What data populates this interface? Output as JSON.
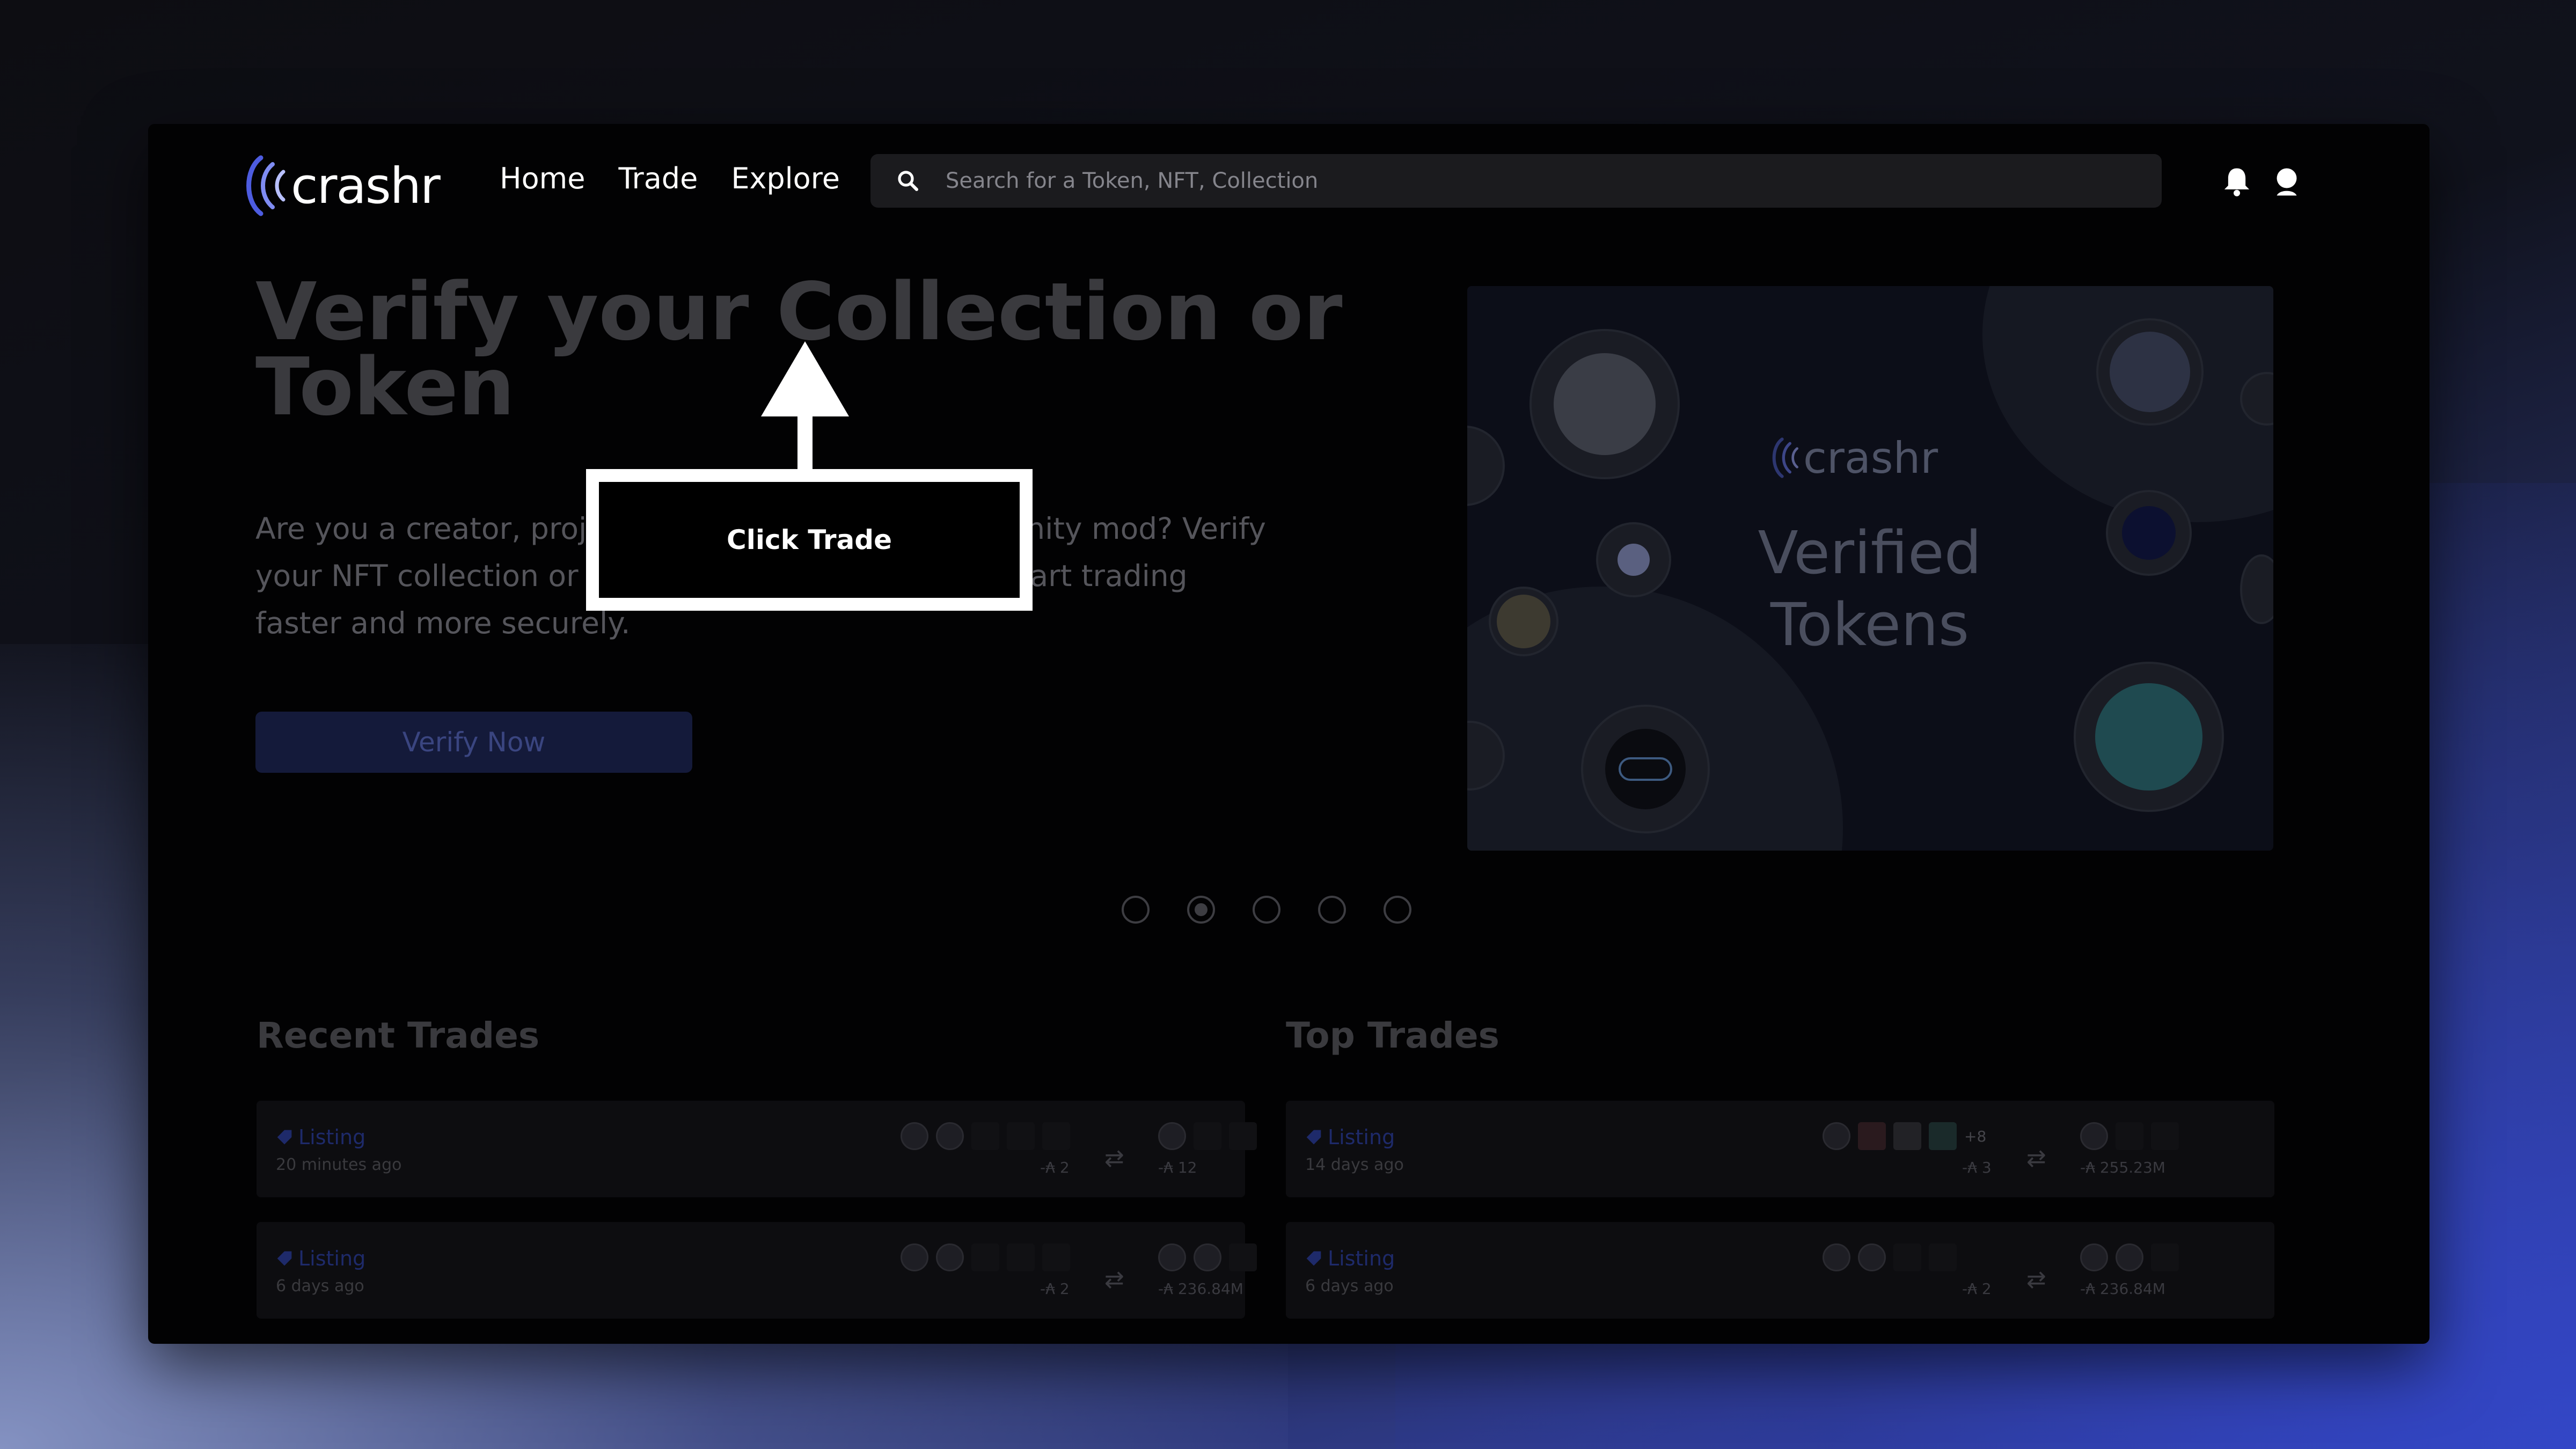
{
  "app": {
    "brand": "crashr"
  },
  "nav": {
    "items": [
      {
        "label": "Home"
      },
      {
        "label": "Trade"
      },
      {
        "label": "Explore"
      }
    ]
  },
  "search": {
    "placeholder": "Search for a Token, NFT, Collection"
  },
  "hero": {
    "title": "Verify your Collection or Token",
    "description": "Are you a creator, project representative, or community mod? Verify your NFT collection or token with a simple form to start trading faster and more securely.",
    "cta_label": "Verify Now"
  },
  "banner": {
    "brand": "crashr",
    "title": "Verified Tokens"
  },
  "carousel": {
    "count": 5,
    "active_index": 1
  },
  "recent_trades": {
    "title": "Recent Trades",
    "rows": [
      {
        "type": "Listing",
        "time": "20 minutes ago",
        "give_amount": "-₳ 2",
        "get_amount": "-₳ 12"
      },
      {
        "type": "Listing",
        "time": "6 days ago",
        "give_amount": "-₳ 2",
        "get_amount": "-₳ 236.84M"
      }
    ]
  },
  "top_trades": {
    "title": "Top Trades",
    "rows": [
      {
        "type": "Listing",
        "time": "14 days ago",
        "give_amount": "-₳ 3",
        "extra_count": "+8",
        "get_amount": "-₳ 255.23M"
      },
      {
        "type": "Listing",
        "time": "6 days ago",
        "give_amount": "-₳ 2",
        "get_amount": "-₳ 236.84M"
      }
    ]
  },
  "tutorial": {
    "instruction": "Click Trade"
  },
  "colors": {
    "accent": "#3a48b8",
    "text": "#ffffff",
    "dim_text": "#3a3a3e"
  },
  "icons": [
    "search-icon",
    "bell-icon",
    "user-icon",
    "tag-icon",
    "swap-icon"
  ]
}
